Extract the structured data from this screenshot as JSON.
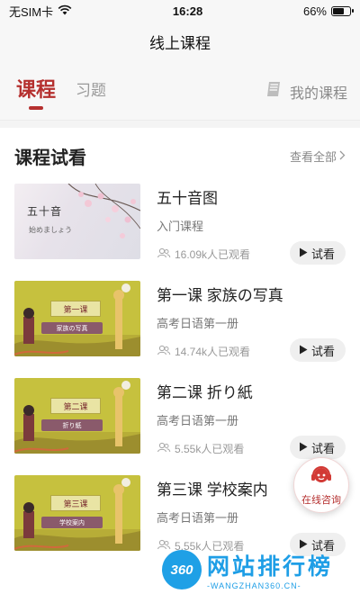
{
  "status_bar": {
    "carrier": "无SIM卡",
    "time": "16:28",
    "battery": "66%",
    "battery_level": 0.66
  },
  "header": {
    "title": "线上课程"
  },
  "tabs": [
    {
      "label": "课程",
      "active": true
    },
    {
      "label": "习题",
      "active": false
    }
  ],
  "my_courses": {
    "label": "我的课程",
    "icon": "book-icon"
  },
  "section": {
    "title": "课程试看",
    "more_label": "查看全部"
  },
  "courses": [
    {
      "title": "五十音图",
      "subtitle": "入门课程",
      "views": "16.09k人已观看",
      "watch_label": "试看",
      "thumb_title": "五十音",
      "thumb_sub": "始めましょう"
    },
    {
      "title": "第一课 家族の写真",
      "subtitle": "高考日语第一册",
      "views": "14.74k人已观看",
      "watch_label": "试看",
      "thumb_title": "第一课",
      "thumb_sub": "家族の写真"
    },
    {
      "title": "第二课 折り紙",
      "subtitle": "高考日语第一册",
      "views": "5.55k人已观看",
      "watch_label": "试看",
      "thumb_title": "第二课",
      "thumb_sub": "折り紙"
    },
    {
      "title": "第三课 学校案内",
      "subtitle": "高考日语第一册",
      "views": "5.55k人已观看",
      "watch_label": "试看",
      "thumb_title": "第三课",
      "thumb_sub": "学校案内"
    }
  ],
  "consult": {
    "label": "在线咨询"
  },
  "watermark": {
    "logo": "360",
    "text": "网站排行榜",
    "url": "-WANGZHAN360.CN-"
  },
  "colors": {
    "accent": "#b5302f",
    "watermark_blue": "#1e9ee6",
    "thumb_green": "#c6c13e"
  }
}
